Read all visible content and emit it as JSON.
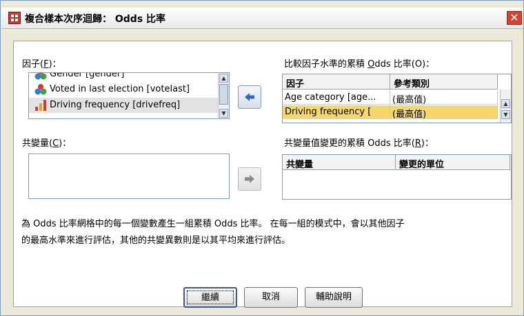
{
  "window": {
    "title": "複合樣本次序迴歸： Odds 比率",
    "close_glyph": "✕"
  },
  "factors": {
    "label_prefix": "因子(",
    "label_key": "F",
    "label_suffix": ")：",
    "items": [
      {
        "label": "Gender [gender]",
        "icon": "categorical-icon"
      },
      {
        "label": "Voted in last election [votelast]",
        "icon": "nominal-icon"
      },
      {
        "label": "Driving frequency [drivefreq]",
        "icon": "ordinal-icon",
        "selected": true
      }
    ]
  },
  "covariates": {
    "label_prefix": "共變量(",
    "label_key": "C",
    "label_suffix": ")："
  },
  "factor_odds": {
    "label_prefix": "比較因子水準的累積 ",
    "label_key": "O",
    "label_mid": "dds 比率(O)：",
    "columns": [
      "因子",
      "參考類別"
    ],
    "rows": [
      [
        "Age category [age...",
        "(最高值)"
      ],
      [
        "Driving frequency [",
        "(最高值)"
      ]
    ]
  },
  "covariate_odds": {
    "label": "共變量值變更的累積 Odds 比率(",
    "label_key": "R",
    "label_suffix": ")：",
    "columns": [
      "共變量",
      "變更的單位"
    ]
  },
  "description": [
    "為 Odds 比率網格中的每一個變數產生一組累積 Odds 比率。 在每一組的模式中，會以其他因子",
    "的最高水準來進行評估，其他的共變異數則是以其平均來進行評估。"
  ],
  "buttons": {
    "continue": "繼續",
    "cancel": "取消",
    "help": "輔助說明"
  }
}
